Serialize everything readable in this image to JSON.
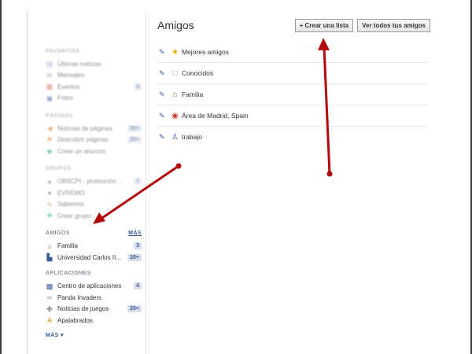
{
  "main": {
    "title": "Amigos",
    "buttons": {
      "create_list": "+ Crear una lista",
      "see_all": "Ver todos tus amigos"
    },
    "lists": [
      {
        "label": "Mejores amigos",
        "icon": "star-icon"
      },
      {
        "label": "Conocidos",
        "icon": "person-outline-icon"
      },
      {
        "label": "Familia",
        "icon": "house-icon"
      },
      {
        "label": "Área de Madrid, Spain",
        "icon": "location-pin-icon"
      },
      {
        "label": "trabajo",
        "icon": "work-person-icon"
      }
    ]
  },
  "sidebar": {
    "favoritos": {
      "title": "Favoritos",
      "items": [
        {
          "label": "Últimas noticias"
        },
        {
          "label": "Mensajes"
        },
        {
          "label": "Eventos",
          "badge": "3"
        },
        {
          "label": "Fotos"
        }
      ]
    },
    "paginas": {
      "title": "Páginas",
      "items": [
        {
          "label": "Noticias de páginas",
          "badge": "20+"
        },
        {
          "label": "Descubrir páginas",
          "badge": "20+"
        },
        {
          "label": "Crear un anuncio"
        }
      ]
    },
    "grupos": {
      "title": "Grupos",
      "items": [
        {
          "label": "OBSCPI - promoción ...",
          "badge": "1"
        },
        {
          "label": "EVREMO"
        },
        {
          "label": "Sabemos"
        },
        {
          "label": "Crear grupo..."
        }
      ]
    },
    "amigos": {
      "title": "Amigos",
      "more": "MÁS",
      "items": [
        {
          "label": "Familia",
          "badge": "3"
        },
        {
          "label": "Universidad Carlos II...",
          "badge": "20+"
        }
      ]
    },
    "aplicaciones": {
      "title": "Aplicaciones",
      "items": [
        {
          "label": "Centro de aplicaciones",
          "badge": "4"
        },
        {
          "label": "Panda Invaders"
        },
        {
          "label": "Noticias de juegos",
          "badge": "20+"
        },
        {
          "label": "Apalabrados"
        }
      ]
    },
    "more_link": "MÁS ▾"
  },
  "colors": {
    "accent": "#3b5998",
    "badge_bg": "#d8dfea",
    "arrow": "#b20a0a"
  }
}
